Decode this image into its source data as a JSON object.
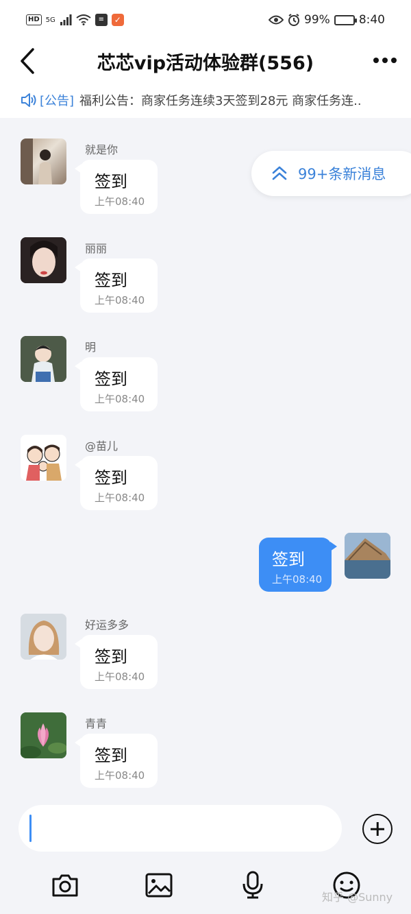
{
  "status_bar": {
    "hd": "HD",
    "signal": "5G",
    "battery": "99%",
    "battery_level": 0.99,
    "time": "8:40"
  },
  "header": {
    "title": "芯芯vip活动体验群(556)"
  },
  "notice": {
    "tag": "[公告]",
    "text": "福利公告：商家任务连续3天签到28元 商家任务连.."
  },
  "new_messages": {
    "label": "99+条新消息"
  },
  "messages": [
    {
      "sender": "就是你",
      "text": "签到",
      "time": "上午08:40",
      "avatar": "avatar-photo-woman-mirror"
    },
    {
      "sender": "丽丽",
      "text": "签到",
      "time": "上午08:40",
      "avatar": "avatar-photo-woman-face"
    },
    {
      "sender": "明",
      "text": "签到",
      "time": "上午08:40",
      "avatar": "avatar-photo-child"
    },
    {
      "sender": "@苗儿",
      "text": "签到",
      "time": "上午08:40",
      "avatar": "avatar-cartoon-family"
    },
    {
      "sender": "",
      "text": "签到",
      "time": "上午08:40",
      "avatar": "avatar-photo-landscape",
      "self": true
    },
    {
      "sender": "好运多多",
      "text": "签到",
      "time": "上午08:40",
      "avatar": "avatar-photo-woman-blonde"
    },
    {
      "sender": "青青",
      "text": "签到",
      "time": "上午08:40",
      "avatar": "avatar-photo-lotus"
    }
  ],
  "watermark": "知乎 @Sunny",
  "colors": {
    "accent": "#3d8ef5",
    "link": "#3b82d9",
    "background": "#f3f4f8"
  }
}
